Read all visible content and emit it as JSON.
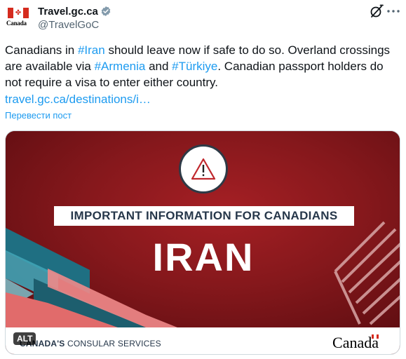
{
  "account": {
    "display_name": "Travel.gc.ca",
    "handle": "@TravelGoC",
    "avatar_word": "Canada",
    "verified_icon": "verified-badge-icon"
  },
  "header_icons": {
    "grok": "grok-icon",
    "more": "more-options-icon"
  },
  "tweet": {
    "part1": "Canadians in ",
    "tag_iran": "#Iran",
    "part2": " should leave now if safe to do so. Overland crossings are available via ",
    "tag_armenia": "#Armenia",
    "part3": " and ",
    "tag_turkiye": "#Türkiye",
    "part4": ". Canadian passport holders do not require a visa to enter either country.",
    "url": "travel.gc.ca/destinations/i…"
  },
  "translate_label": "Перевести пост",
  "media": {
    "banner": "IMPORTANT INFORMATION FOR CANADIANS",
    "country": "IRAN",
    "footer_bold": "CANADA'S",
    "footer_rest": " CONSULAR SERVICES",
    "wordmark": "Canada",
    "alt_label": "ALT"
  },
  "colors": {
    "accent": "#1d9bf0",
    "media_red": "#8b1a1f",
    "flag_red": "#d52b1e",
    "teal": "#2a8b9a",
    "navy": "#26374a"
  }
}
